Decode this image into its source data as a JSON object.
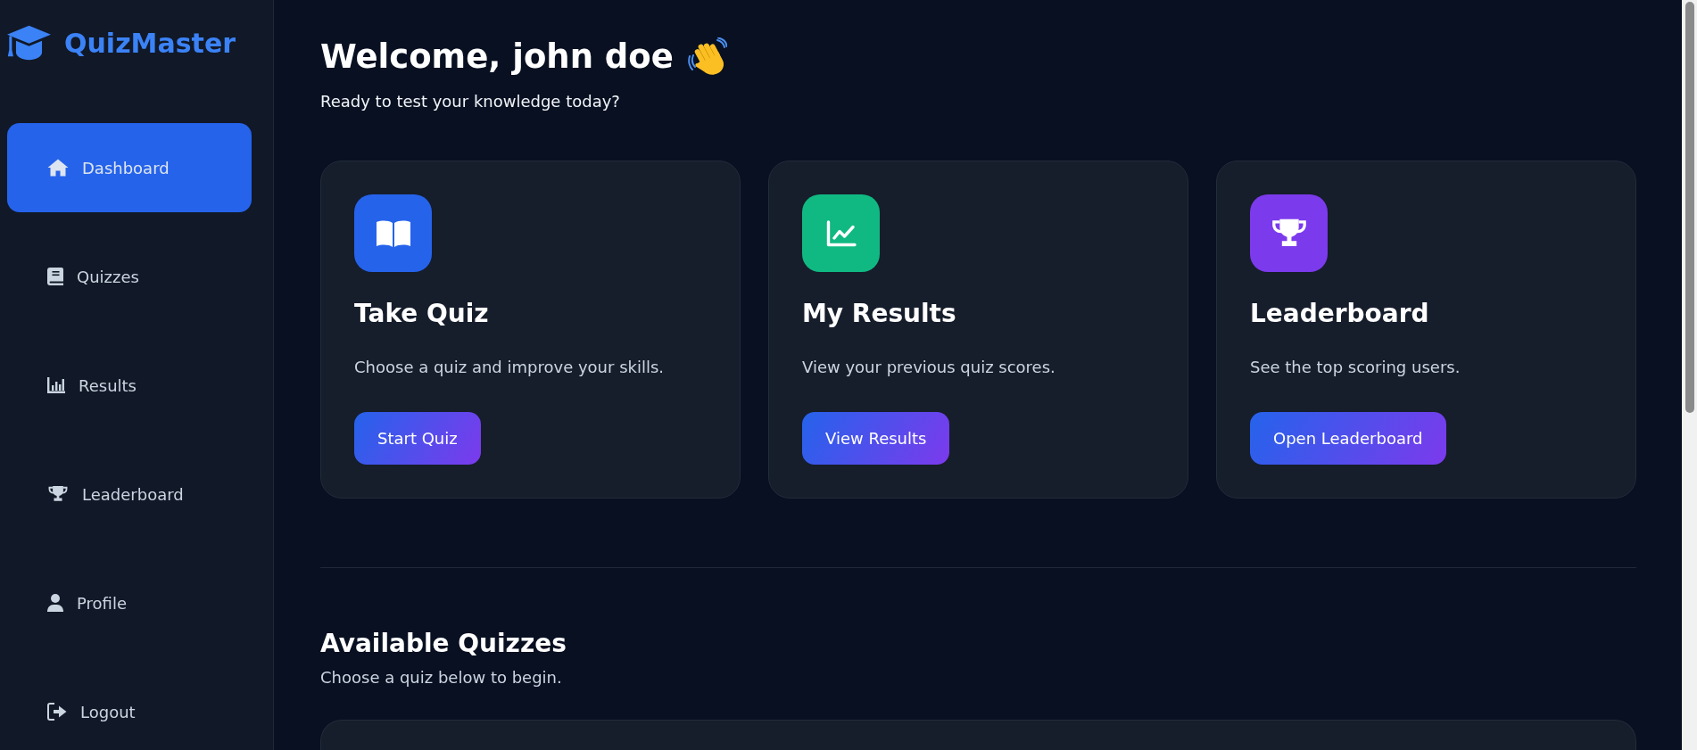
{
  "sidebar": {
    "logo": "QuizMaster",
    "items": [
      {
        "label": "Dashboard",
        "selected": true
      },
      {
        "label": "Quizzes",
        "selected": false
      },
      {
        "label": "Results",
        "selected": false
      },
      {
        "label": "Leaderboard",
        "selected": false
      },
      {
        "label": "Profile",
        "selected": false
      },
      {
        "label": "Logout",
        "selected": false
      }
    ]
  },
  "header": {
    "title": "Welcome, john doe",
    "subtitle": "Ready to test your knowledge today?"
  },
  "cards": [
    {
      "title": "Take Quiz",
      "description": "Choose a quiz and improve your skills.",
      "button": "Start Quiz",
      "color": "#2563eb"
    },
    {
      "title": "My Results",
      "description": "View your previous quiz scores.",
      "button": "View Results",
      "color": "#10b981"
    },
    {
      "title": "Leaderboard",
      "description": "See the top scoring users.",
      "button": "Open Leaderboard",
      "color": "#7c3aed"
    }
  ],
  "quizzes_section": {
    "title": "Available Quizzes",
    "subtitle": "Choose a quiz below to begin."
  }
}
